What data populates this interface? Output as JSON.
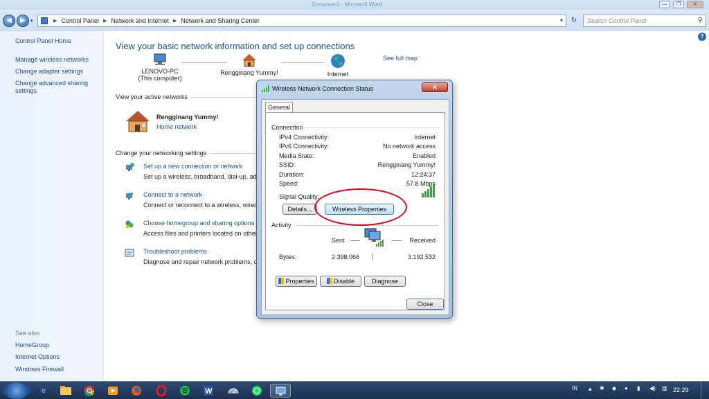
{
  "window": {
    "title_faded": "Document1 - Microsoft Word",
    "controls": [
      "—",
      "❐",
      "✕"
    ]
  },
  "addressbar": {
    "back": "◀",
    "forward": "▶",
    "crumbs": [
      "Control Panel",
      "Network and Internet",
      "Network and Sharing Center"
    ],
    "refresh": "↻",
    "search_placeholder": "Search Control Panel"
  },
  "left_nav": {
    "home": "Control Panel Home",
    "links": [
      "Manage wireless networks",
      "Change adapter settings",
      "Change advanced sharing settings"
    ],
    "see_also_label": "See also",
    "see_also": [
      "HomeGroup",
      "Internet Options",
      "Windows Firewall"
    ]
  },
  "main": {
    "help": "?",
    "title": "View your basic network information and set up connections",
    "see_full_map": "See full map",
    "map": {
      "computer_name": "LENOVO-PC",
      "computer_sub": "(This computer)",
      "network_name": "Rengginang Yummy!",
      "internet": "Internet"
    },
    "active_header": "View your active networks",
    "active_network": {
      "name": "Rengginang Yummy!",
      "type": "Home network"
    },
    "change_header": "Change your networking settings",
    "tasks": [
      {
        "link": "Set up a new connection or network",
        "desc": "Set up a wireless, broadband, dial-up, ad"
      },
      {
        "link": "Connect to a network",
        "desc": "Connect or reconnect to a wireless, wired"
      },
      {
        "link": "Choose homegroup and sharing options",
        "desc": "Access files and printers located on other"
      },
      {
        "link": "Troubleshoot problems",
        "desc": "Diagnose and repair network problems, o"
      }
    ]
  },
  "dialog": {
    "title": "Wireless Network Connection Status",
    "close_x": "✕",
    "tab": "General",
    "connection_label": "Connection",
    "rows": [
      {
        "k": "IPv4 Connectivity:",
        "v": "Internet"
      },
      {
        "k": "IPv6 Connectivity:",
        "v": "No network access"
      },
      {
        "k": "Media State:",
        "v": "Enabled"
      },
      {
        "k": "SSID:",
        "v": "Rengginang Yummy!"
      },
      {
        "k": "Duration:",
        "v": "12:24:37"
      },
      {
        "k": "Speed:",
        "v": "57.8 Mbps"
      }
    ],
    "signal_label": "Signal Quality:",
    "signal_bars": 5,
    "details_btn": "Details...",
    "wireless_props_btn": "Wireless Properties",
    "activity_label": "Activity",
    "sent_label": "Sent",
    "received_label": "Received",
    "bytes_label": "Bytes:",
    "bytes_sent": "2.398.066",
    "bytes_received": "3.192.532",
    "properties_btn": "Properties",
    "disable_btn": "Disable",
    "diagnose_btn": "Diagnose",
    "close_btn": "Close",
    "annotation_color": "#e1001f"
  },
  "taskbar": {
    "tray_lang": "IN",
    "clock": "22:29",
    "items": [
      "ie-icon",
      "explorer-icon",
      "chrome-icon",
      "media-icon",
      "firefox-icon",
      "opera-icon",
      "spotify-icon",
      "word-icon",
      "speed-icon",
      "whatsapp-icon",
      "network-window-icon"
    ]
  }
}
